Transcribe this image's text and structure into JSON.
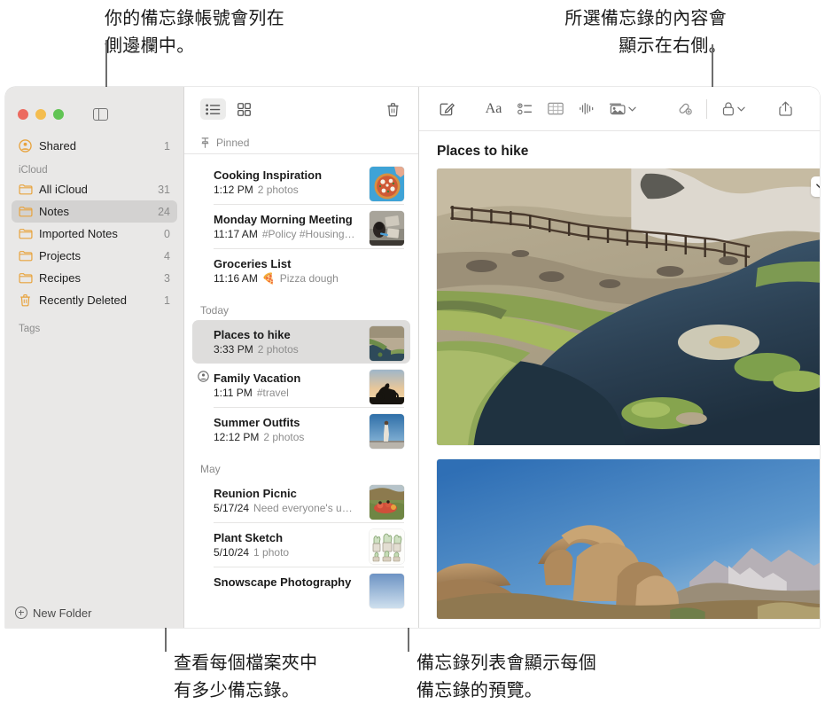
{
  "annotations": {
    "top_left": "你的備忘錄帳號會列在\n側邊欄中。",
    "top_right": "所選備忘錄的內容會\n顯示在右側。",
    "bottom_left": "查看每個檔案夾中\n有多少備忘錄。",
    "bottom_right": "備忘錄列表會顯示每個\n備忘錄的預覽。"
  },
  "window": {
    "traffic_lights": [
      "close-red",
      "minimize-yellow",
      "zoom-green"
    ],
    "sidebar_toggle_icon": "sidebar-toggle-icon"
  },
  "sidebar": {
    "top_items": [
      {
        "icon": "shared-person-icon",
        "label": "Shared",
        "count": "1"
      }
    ],
    "sections": [
      {
        "header": "iCloud",
        "items": [
          {
            "icon": "folder-icon",
            "label": "All iCloud",
            "count": "31",
            "selected": false
          },
          {
            "icon": "folder-icon",
            "label": "Notes",
            "count": "24",
            "selected": true
          },
          {
            "icon": "folder-icon",
            "label": "Imported Notes",
            "count": "0",
            "selected": false
          },
          {
            "icon": "folder-icon",
            "label": "Projects",
            "count": "4",
            "selected": false
          },
          {
            "icon": "folder-icon",
            "label": "Recipes",
            "count": "3",
            "selected": false
          },
          {
            "icon": "trash-icon",
            "label": "Recently Deleted",
            "count": "1",
            "selected": false
          }
        ]
      },
      {
        "header": "Tags",
        "items": []
      }
    ],
    "footer": {
      "icon": "plus-circle-icon",
      "label": "New Folder"
    }
  },
  "notes_list": {
    "toolbar": {
      "list_view_label": "list-view-icon",
      "gallery_view_label": "gallery-view-icon",
      "delete_label": "trash-icon",
      "active_view": "list"
    },
    "pinned_header": {
      "icon": "pin-icon",
      "label": "Pinned"
    },
    "groups": [
      {
        "header": "",
        "notes": [
          {
            "title": "Cooking Inspiration",
            "time": "1:12 PM",
            "preview": "2 photos",
            "thumb": "pizza",
            "shared": false
          },
          {
            "title": "Monday Morning Meeting",
            "time": "11:17 AM",
            "preview": "#Policy #Housing…",
            "thumb": "meeting",
            "shared": false
          },
          {
            "title": "Groceries List",
            "time": "11:16 AM",
            "preview": "Pizza dough",
            "emoji": "🍕",
            "thumb": null,
            "shared": false
          }
        ]
      },
      {
        "header": "Today",
        "notes": [
          {
            "title": "Places to hike",
            "time": "3:33 PM",
            "preview": "2 photos",
            "thumb": "river",
            "shared": false,
            "selected": true
          },
          {
            "title": "Family Vacation",
            "time": "1:11 PM",
            "preview": "#travel",
            "thumb": "bike-silhouette",
            "shared": true
          },
          {
            "title": "Summer Outfits",
            "time": "12:12 PM",
            "preview": "2 photos",
            "thumb": "person-sky",
            "shared": false
          }
        ]
      },
      {
        "header": "May",
        "notes": [
          {
            "title": "Reunion Picnic",
            "time": "5/17/24",
            "preview": "Need everyone's u…",
            "thumb": "picnic",
            "shared": false
          },
          {
            "title": "Plant Sketch",
            "time": "5/10/24",
            "preview": "1 photo",
            "thumb": "plant-sketch",
            "shared": false
          },
          {
            "title": "Snowscape Photography",
            "time": "",
            "preview": "",
            "thumb": "snow",
            "shared": false
          }
        ]
      }
    ]
  },
  "detail": {
    "toolbar_icons": [
      "compose-icon",
      "format-aa-icon",
      "checklist-icon",
      "table-icon",
      "audio-waveform-icon",
      "media-icon",
      "media-chevron-down-icon",
      "collaborate-link-icon",
      "lock-icon",
      "lock-chevron-down-icon",
      "share-icon",
      "search-icon"
    ],
    "title": "Places to hike",
    "photos": [
      {
        "name": "hot-creek-river-photo",
        "menu_icon": "chevron-down-icon"
      },
      {
        "name": "mobius-arch-photo",
        "menu_icon": null
      }
    ]
  },
  "colors": {
    "folder_yellow": "#e8a33d",
    "sidebar_bg": "#e9e8e7",
    "selected_row": "#d3d2d1",
    "note_selected": "#dedddc",
    "text_primary": "#1b1b1b",
    "text_secondary": "#8d8d8d",
    "traffic_red": "#ec6a5f",
    "traffic_yellow": "#f4bd4f",
    "traffic_green": "#61c454"
  }
}
